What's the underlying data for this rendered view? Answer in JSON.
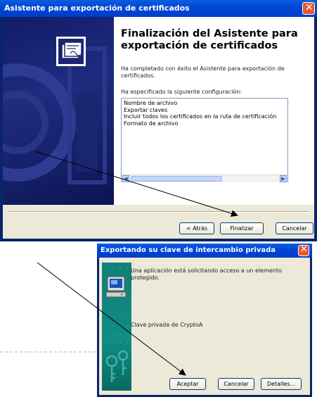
{
  "export_wizard": {
    "title": "Asistente para exportación de certificados",
    "heading": "Finalización del Asistente para exportación de certificados",
    "description": "Ha completado con éxito el Asistente para exportación de certificados.",
    "config_label": "Ha especificado la siguiente configuración:",
    "config_items": [
      "Nombre de archivo",
      "Exportar claves",
      "Incluir todos los certificados en la ruta de certificación",
      "Formato de archivo"
    ],
    "buttons": {
      "back": "< Atrás",
      "finish": "Finalizar",
      "cancel": "Cancelar"
    }
  },
  "private_key_dialog": {
    "title": "Exportando su clave de intercambio privada",
    "message": "Una aplicación está solicitando acceso a un elemento protegido.",
    "key_label": "Clave privada de CryptoA",
    "buttons": {
      "accept": "Aceptar",
      "cancel": "Cancelar",
      "details": "Detalles..."
    }
  },
  "colors": {
    "titlebar": "#0047d6",
    "close_button": "#e45a36",
    "dialog_face": "#ece9d8",
    "wizard_sidebar": "#1f2c7f",
    "dialog_sidebar": "#108c85"
  }
}
